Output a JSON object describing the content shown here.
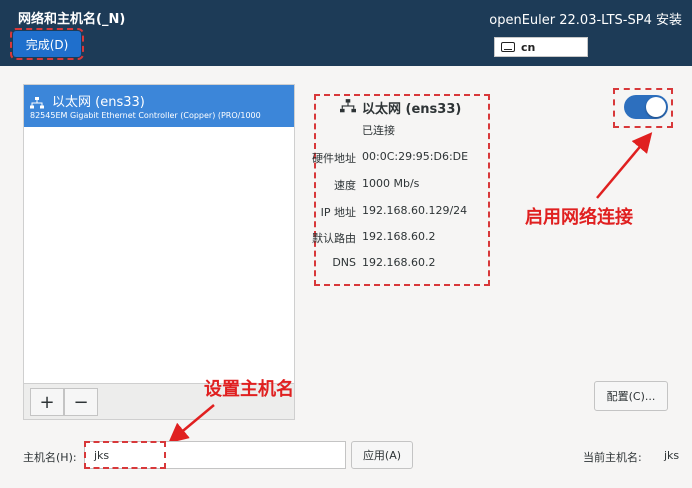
{
  "header": {
    "title": "网络和主机名(_N)",
    "done_label": "完成(D)",
    "product": "openEuler 22.03-LTS-SP4 安装",
    "keyboard_layout": "cn"
  },
  "connections": [
    {
      "name": "以太网 (ens33)",
      "device": "82545EM Gigabit Ethernet Controller (Copper) (PRO/1000"
    }
  ],
  "list_toolbar": {
    "add": "+",
    "remove": "−"
  },
  "detail": {
    "title": "以太网 (ens33)",
    "status": "已连接",
    "rows": [
      {
        "label": "硬件地址",
        "value": "00:0C:29:95:D6:DE"
      },
      {
        "label": "速度",
        "value": "1000 Mb/s"
      },
      {
        "label": "IP 地址",
        "value": "192.168.60.129/24"
      },
      {
        "label": "默认路由",
        "value": "192.168.60.2"
      },
      {
        "label": "DNS",
        "value": "192.168.60.2"
      }
    ]
  },
  "toggle": {
    "enabled": true
  },
  "annotations": {
    "enable_connection": "启用网络连接",
    "set_hostname": "设置主机名"
  },
  "config_button": "配置(C)...",
  "hostname": {
    "label": "主机名(H):",
    "value": "jks",
    "apply_label": "应用(A)",
    "current_label": "当前主机名:",
    "current_value": "jks"
  },
  "colors": {
    "header_bg": "#1d3b57",
    "accent": "#3c86d9",
    "annotation": "#e02020"
  }
}
